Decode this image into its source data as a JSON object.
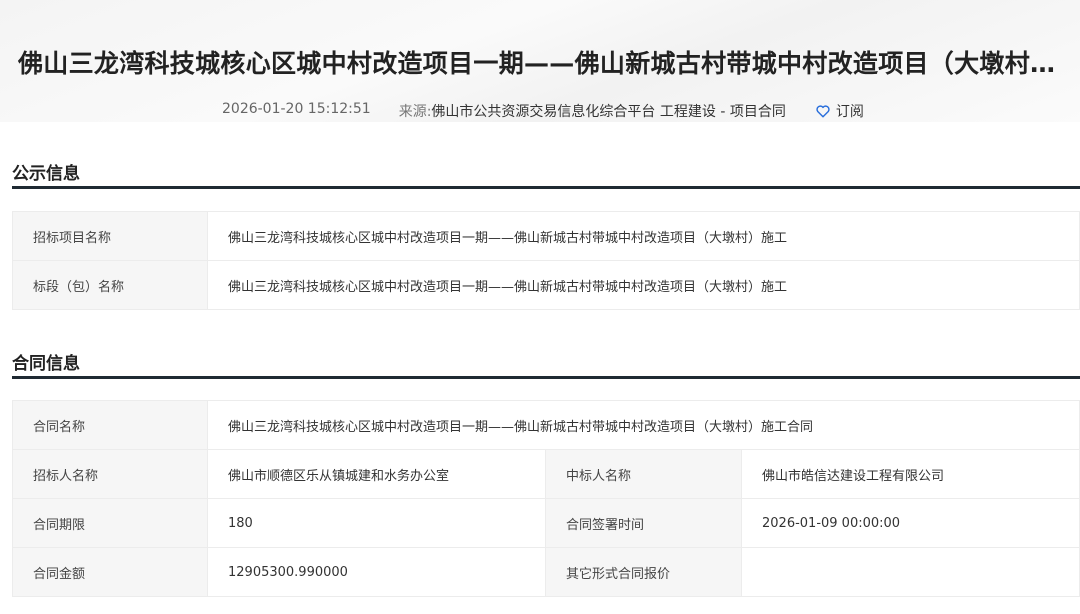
{
  "header": {
    "title": "佛山三龙湾科技城核心区城中村改造项目一期——佛山新城古村带城中村改造项目（大墩村）施工合同",
    "time": "2026-01-20 15:12:51",
    "source_label": "来源:",
    "source": "佛山市公共资源交易信息化综合平台 工程建设 - 项目合同",
    "subscribe": "订阅"
  },
  "notice": {
    "heading": "公示信息",
    "rows": [
      {
        "label": "招标项目名称",
        "value": "佛山三龙湾科技城核心区城中村改造项目一期——佛山新城古村带城中村改造项目（大墩村）施工"
      },
      {
        "label": "标段（包）名称",
        "value": "佛山三龙湾科技城核心区城中村改造项目一期——佛山新城古村带城中村改造项目（大墩村）施工"
      }
    ]
  },
  "contract": {
    "heading": "合同信息",
    "name_label": "合同名称",
    "name": "佛山三龙湾科技城核心区城中村改造项目一期——佛山新城古村带城中村改造项目（大墩村）施工合同",
    "tenderer_label": "招标人名称",
    "tenderer": "佛山市顺德区乐从镇城建和水务办公室",
    "winner_label": "中标人名称",
    "winner": "佛山市皓信达建设工程有限公司",
    "period_label": "合同期限",
    "period": "180",
    "sign_label": "合同签署时间",
    "sign": "2026-01-09 00:00:00",
    "amount_label": "合同金额",
    "amount": "12905300.990000",
    "other_label": "其它形式合同报价",
    "other": ""
  }
}
